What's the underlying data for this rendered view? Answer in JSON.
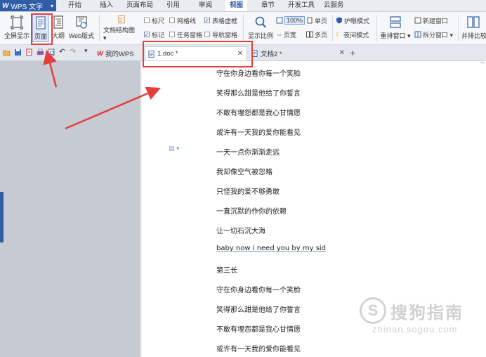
{
  "app": {
    "logo_letter": "W",
    "name": "WPS 文字"
  },
  "menu": {
    "items": [
      "开始",
      "插入",
      "页面布局",
      "引用",
      "审阅",
      "视图",
      "章节",
      "开发工具",
      "云服务"
    ],
    "active": "视图"
  },
  "ribbon": {
    "fullscreen": "全屏显示",
    "page_view": "页面",
    "outline": "大纲",
    "web_layout": "Web版式",
    "doc_map": "文档结构图",
    "ruler": "标尺",
    "gridlines": "网格线",
    "table_gridlines": "表格虚框",
    "marks": "标记",
    "task_pane": "任务窗格",
    "nav_pane": "导航窗格",
    "zoom_label": "显示比例",
    "zoom_value": "100%",
    "page_width": "页宽",
    "single_page": "单页",
    "multi_page": "多页",
    "eye_protect": "护眼模式",
    "night_mode": "夜间模式",
    "rearrange": "重排窗口",
    "new_window": "新建窗口",
    "split_window": "拆分窗口",
    "side_by_side": "并排比较"
  },
  "tabs": [
    {
      "label": "我的WPS",
      "active": false
    },
    {
      "label": "1.doc *",
      "active": true
    },
    {
      "label": "文档2 *",
      "active": false
    }
  ],
  "document": {
    "lines": [
      "守在你身边看你每一个笑脸",
      "笑得那么甜是他给了你誓言",
      "不敢有埋怨都是我心甘情愿",
      "或许有一天我的爱你能看见",
      "一天一点你渐渐走远",
      "我却像空气被忽略",
      "只怪我的爱不够勇敢",
      "一直沉默的作你的依赖",
      "让一切石沉大海",
      "baby now i need you by my sid",
      "第三长",
      "守在你身边看你每一个笑脸",
      "笑得那么甜是他给了你誓言",
      "不敢有埋怨都是我心甘情愿",
      "或许有一天我的爱你能看见"
    ]
  },
  "watermark": {
    "logo": "S",
    "cn": "搜狗指南",
    "en": "zhinan.sogou.com"
  },
  "colors": {
    "accent": "#2f5da8",
    "annotation": "#e63d3d"
  }
}
